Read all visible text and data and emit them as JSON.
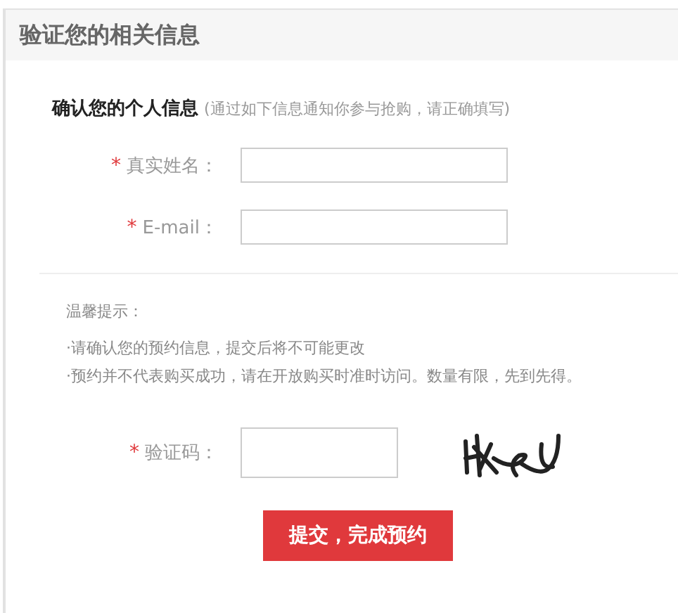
{
  "panel": {
    "title": "验证您的相关信息"
  },
  "section": {
    "title": "确认您的个人信息",
    "note": "(通过如下信息通知你参与抢购，请正确填写)"
  },
  "fields": [
    {
      "label": "真实姓名：",
      "required": true,
      "mark": "*"
    },
    {
      "label": "E-mail：",
      "required": true,
      "mark": "*"
    }
  ],
  "tips": {
    "title": "温馨提示：",
    "items": [
      "·请确认您的预约信息，提交后将不可能更改",
      "·预约并不代表购买成功，请在开放购买时准时访问。数量有限，先到先得。"
    ]
  },
  "captcha": {
    "label": "验证码：",
    "required": true,
    "mark": "*"
  },
  "submit": "提交，完成预约"
}
